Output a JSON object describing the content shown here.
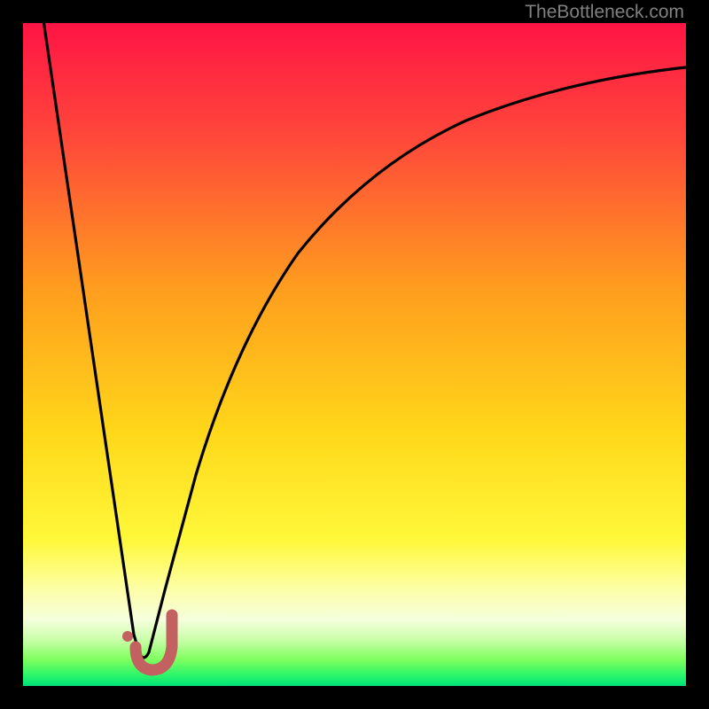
{
  "attribution": "TheBottleneck.com",
  "colors": {
    "top": "#ff1a4a",
    "mid_upper": "#ff7a1a",
    "mid": "#ffd400",
    "green_band_top": "#f5ff80",
    "green_band_mid": "#8fff40",
    "green": "#00e54f",
    "black": "#000000",
    "curve": "#000000",
    "checkmark": "#c86464"
  },
  "chart_data": {
    "type": "line",
    "title": "",
    "xlabel": "",
    "ylabel": "",
    "xlim": [
      0,
      100
    ],
    "ylim": [
      0,
      100
    ],
    "series": [
      {
        "name": "bottleneck-curve",
        "x": [
          3,
          6,
          9,
          12,
          15,
          16.5,
          18,
          20,
          23,
          27,
          31,
          35,
          40,
          46,
          53,
          61,
          70,
          80,
          90,
          100
        ],
        "y": [
          100,
          80,
          60,
          40,
          20,
          6,
          3,
          8,
          19,
          33,
          45,
          55,
          63,
          70,
          76,
          81,
          85,
          88,
          90,
          91
        ]
      }
    ],
    "annotations": [
      {
        "name": "optimal-checkmark",
        "x": 17.5,
        "y": 4,
        "shape": "check"
      }
    ]
  }
}
